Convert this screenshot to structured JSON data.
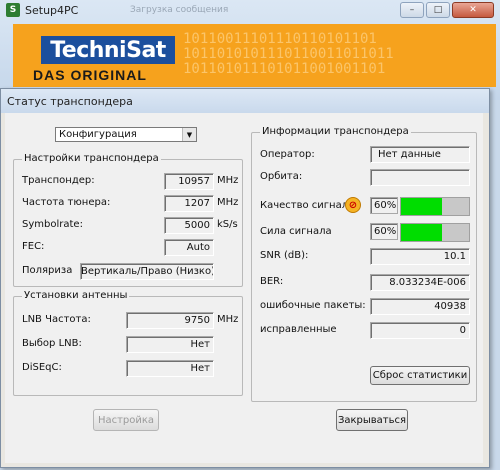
{
  "app": {
    "title": "Setup4PC",
    "ghost_text": "Загрузка сообщения"
  },
  "banner": {
    "logo": "TechniSat",
    "tagline": "DAS ORIGINAL",
    "binary": "10110011101110110101101\n1011010101110110011011011\n101101011101011001001101"
  },
  "dialog": {
    "title": "Статус транспондера",
    "config_select": "Конфигурация",
    "transponder_group": {
      "title": "Настройки транспондера",
      "rows": [
        {
          "label": "Транспондер:",
          "value": "10957",
          "unit": "MHz"
        },
        {
          "label": "Частота тюнера:",
          "value": "1207",
          "unit": "MHz"
        },
        {
          "label": "Symbolrate:",
          "value": "5000",
          "unit": "kS/s"
        },
        {
          "label": "FEC:",
          "value": "Auto",
          "unit": ""
        }
      ],
      "polar_label": "Поляриза",
      "polar_value": "Вертикаль/Право (Низко)"
    },
    "antenna_group": {
      "title": "Установки антенны",
      "rows": [
        {
          "label": "LNB Частота:",
          "value": "9750",
          "unit": "MHz"
        },
        {
          "label": "Выбор LNB:",
          "value": "Нет",
          "unit": ""
        },
        {
          "label": "DiSEqC:",
          "value": "Нет",
          "unit": ""
        }
      ]
    },
    "info_group": {
      "title": "Информации транспондера",
      "operator_label": "Оператор:",
      "operator_value": "Нет данные",
      "orbit_label": "Орбита:",
      "orbit_value": "",
      "quality_label": "Качество сигнал.",
      "quality_pct": "60%",
      "quality_level": 0.6,
      "strength_label": "Сила сигнала",
      "strength_pct": "60%",
      "strength_level": 0.6,
      "snr_label": "SNR (dB):",
      "snr_value": "10.1",
      "ber_label": "BER:",
      "ber_value": "8.033234E-006",
      "err_label": "ошибочные пакеты:",
      "err_value": "40938",
      "fixed_label": "исправленные",
      "fixed_value": "0",
      "reset_button": "Сброс статистики"
    },
    "settings_button": "Настройка",
    "close_button": "Закрываться"
  },
  "colors": {
    "bar_fill": "#00dd00",
    "banner_orange": "#f6a21d",
    "logo_blue": "#1c4f9d"
  },
  "icons": {
    "app": "satellite-app-icon",
    "warning": "warning-icon"
  }
}
